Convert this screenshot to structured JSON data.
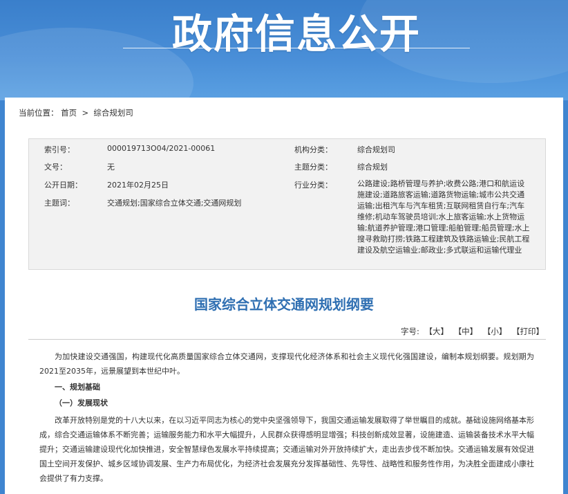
{
  "banner": {
    "title": "政府信息公开"
  },
  "breadcrumb": {
    "prefix": "当前位置：",
    "home": "首页",
    "sep": " > ",
    "current": "综合规划司"
  },
  "meta": {
    "index_label": "索引号：",
    "index_value": "000019713O04/2021-00061",
    "org_label": "机构分类：",
    "org_value": "综合规划司",
    "docno_label": "文号：",
    "docno_value": "无",
    "topic_label": "主题分类：",
    "topic_value": "综合规划",
    "date_label": "公开日期：",
    "date_value": "2021年02月25日",
    "industry_label": "行业分类：",
    "industry_value": "公路建设;路桥管理与养护;收费公路;港口和航运设施建设;道路旅客运输;道路货物运输;城市公共交通运输;出租汽车与汽车租赁;互联网租赁自行车;汽车维修;机动车驾驶员培训;水上旅客运输;水上货物运输;航道养护管理;港口管理;船舶管理;船员管理;水上搜寻救助打捞;铁路工程建筑及铁路运输业;民航工程建设及航空运输业;邮政业;多式联运和运输代理业",
    "keywords_label": "主题词：",
    "keywords_value": "交通规划;国家综合立体交通;交通网规划"
  },
  "document": {
    "title": "国家综合立体交通网规划纲要",
    "fontsize_label": "字号:",
    "size_large": "【大】",
    "size_medium": "【中】",
    "size_small": "【小】",
    "print": "【打印】",
    "para1": "为加快建设交通强国，构建现代化高质量国家综合立体交通网，支撑现代化经济体系和社会主义现代化强国建设，编制本规划纲要。规划期为2021至2035年，远景展望到本世纪中叶。",
    "heading1": "一、规划基础",
    "heading2": "（一）发展现状",
    "para2": "改革开放特别是党的十八大以来，在以习近平同志为核心的党中央坚强领导下，我国交通运输发展取得了举世瞩目的成就。基础设施网络基本形成，综合交通运输体系不断完善；运输服务能力和水平大幅提升，人民群众获得感明显增强；科技创新成效显著，设施建造、运输装备技术水平大幅提升；交通运输建设现代化加快推进，安全智慧绿色发展水平持续提高；交通运输对外开放持续扩大，走出去步伐不断加快。交通运输发展有效促进国土空间开发保护、城乡区域协调发展、生产力布局优化，为经济社会发展充分发挥基础性、先导性、战略性和服务性作用，为决胜全面建成小康社会提供了有力支撑。"
  }
}
